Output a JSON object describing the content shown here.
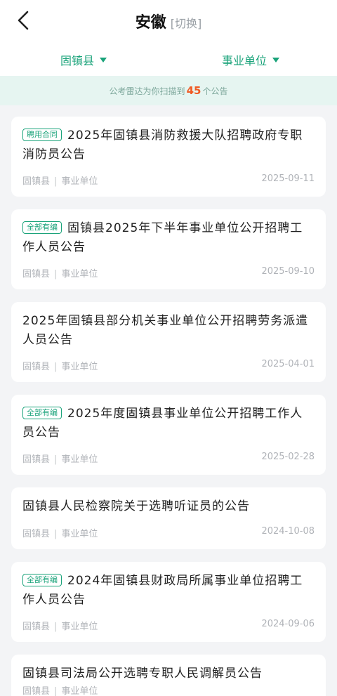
{
  "header": {
    "title": "安徽",
    "switch_label": "[切换]"
  },
  "filters": {
    "region": "固镇县",
    "type": "事业单位"
  },
  "banner": {
    "prefix": "公考雷达为你扫描到",
    "count": "45",
    "suffix": "个公告"
  },
  "items": [
    {
      "tag": "聘用合同",
      "title": "2025年固镇县消防救援大队招聘政府专职消防员公告",
      "region": "固镇县",
      "category": "事业单位",
      "date": "2025-09-11"
    },
    {
      "tag": "全部有编",
      "title": "固镇县2025年下半年事业单位公开招聘工作人员公告",
      "region": "固镇县",
      "category": "事业单位",
      "date": "2025-09-10"
    },
    {
      "tag": "",
      "title": "2025年固镇县部分机关事业单位公开招聘劳务派遣人员公告",
      "region": "固镇县",
      "category": "事业单位",
      "date": "2025-04-01"
    },
    {
      "tag": "全部有编",
      "title": "2025年度固镇县事业单位公开招聘工作人员公告",
      "region": "固镇县",
      "category": "事业单位",
      "date": "2025-02-28"
    },
    {
      "tag": "",
      "title": "固镇县人民检察院关于选聘听证员的公告",
      "region": "固镇县",
      "category": "事业单位",
      "date": "2024-10-08"
    },
    {
      "tag": "全部有编",
      "title": "2024年固镇县财政局所属事业单位招聘工作人员公告",
      "region": "固镇县",
      "category": "事业单位",
      "date": "2024-09-06"
    },
    {
      "tag": "",
      "title": "固镇县司法局公开选聘专职人民调解员公告",
      "region": "固镇县",
      "category": "事业单位",
      "date": ""
    }
  ],
  "colors": {
    "accent": "#1aa37a",
    "highlight": "#f05a24",
    "banner_bg": "#e6f5f1"
  }
}
